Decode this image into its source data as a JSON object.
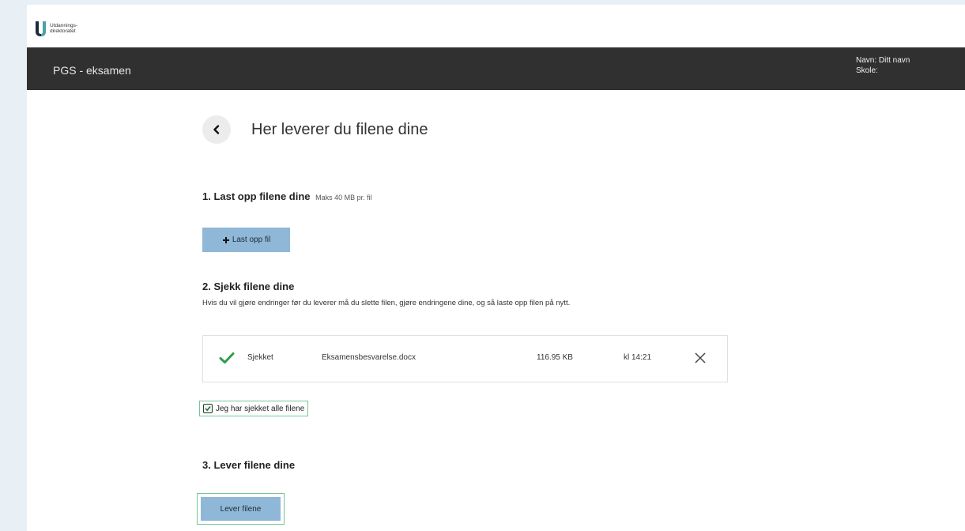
{
  "logo": {
    "line1": "Utdannings-",
    "line2": "direktoratet"
  },
  "header": {
    "app_title": "PGS - eksamen",
    "name_label": "Navn:",
    "name_value": "Ditt navn",
    "school_label": "Skole:",
    "school_value": ""
  },
  "page": {
    "title": "Her leverer du filene dine"
  },
  "step1": {
    "heading": "1. Last opp filene dine",
    "hint": "Maks 40 MB pr. fil",
    "upload_label": "Last opp fil"
  },
  "step2": {
    "heading": "2. Sjekk filene dine",
    "description": "Hvis du vil gjøre endringer før du leverer må du slette filen, gjøre endringene dine, og så laste opp filen på nytt.",
    "files": [
      {
        "status": "Sjekket",
        "name": "Eksamensbesvarelse.docx",
        "size": "116.95 KB",
        "time": "kl 14:21"
      }
    ],
    "confirm_label": "Jeg har sjekket alle filene",
    "confirm_checked": true
  },
  "step3": {
    "heading": "3. Lever filene dine",
    "submit_label": "Lever filene"
  },
  "colors": {
    "accent": "#8fb8d8",
    "nav": "#303030",
    "success": "#2e9e4a",
    "focus": "#74c79b"
  }
}
